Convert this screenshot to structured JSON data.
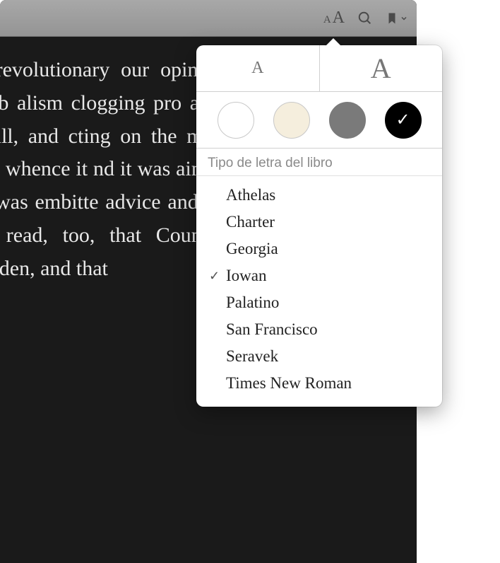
{
  "reader": {
    "text": "h the revolutionary our opinion the da volutionary hydra, b alism clogging pro article, too, a finan ham and Mill, and cting on the min ickwittedness he ca divined whence it nd it was aimed, a ys did, a certain s action was embitte advice and the unsatisfactory state d. He read, too, that Count Beist have left for Wiesbaden, and that"
  },
  "popover": {
    "sectionHeader": "Tipo de letra del libro",
    "fonts": [
      {
        "name": "Athelas",
        "selected": false
      },
      {
        "name": "Charter",
        "selected": false
      },
      {
        "name": "Georgia",
        "selected": false
      },
      {
        "name": "Iowan",
        "selected": true
      },
      {
        "name": "Palatino",
        "selected": false
      },
      {
        "name": "San Francisco",
        "selected": false
      },
      {
        "name": "Seravek",
        "selected": false
      },
      {
        "name": "Times New Roman",
        "selected": false
      }
    ],
    "themes": {
      "white": "#ffffff",
      "sepia": "#f5eedd",
      "gray": "#7a7a7a",
      "black": "#000000",
      "selected": "black"
    }
  }
}
